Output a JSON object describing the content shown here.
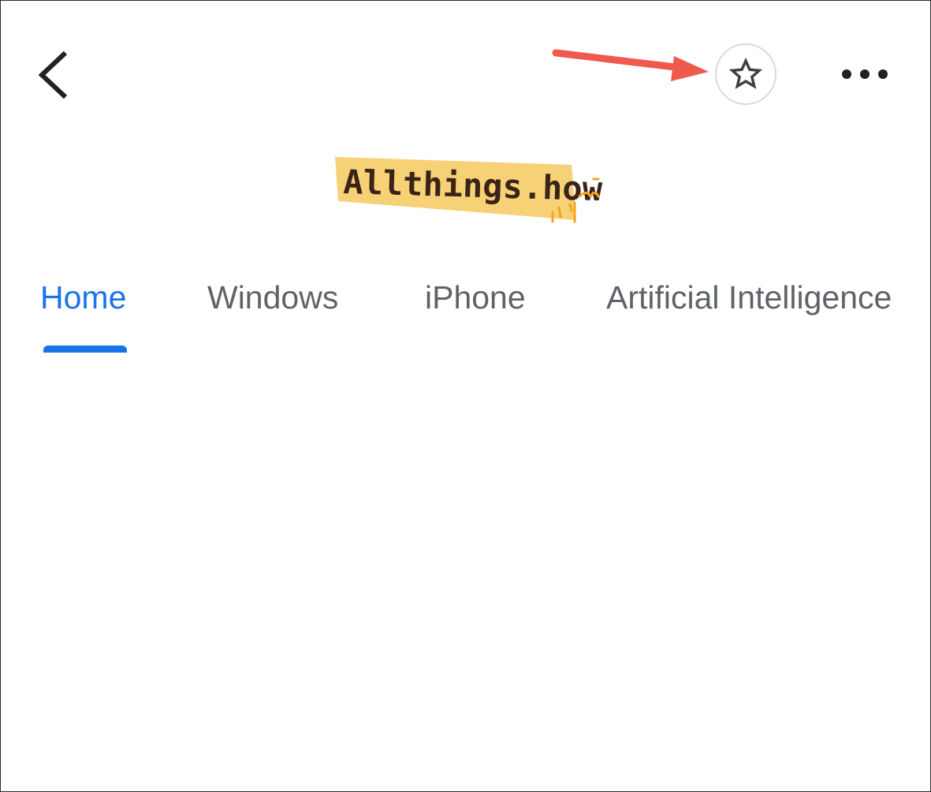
{
  "header": {
    "back_icon": "chevron-left-icon",
    "follow_icon": "star-outline-icon",
    "more_icon": "more-horizontal-icon"
  },
  "logo": {
    "text": "Allthings.how"
  },
  "tabs": [
    {
      "label": "Home",
      "selected": true
    },
    {
      "label": "Windows",
      "selected": false
    },
    {
      "label": "iPhone",
      "selected": false
    },
    {
      "label": "Artificial Intelligence",
      "selected": false
    }
  ],
  "colors": {
    "accent": "#1a73e8",
    "tab_text": "#5f6368",
    "annotation_arrow": "#ef5a4c",
    "logo_highlight": "#f7d175",
    "logo_text": "#3a2418"
  }
}
